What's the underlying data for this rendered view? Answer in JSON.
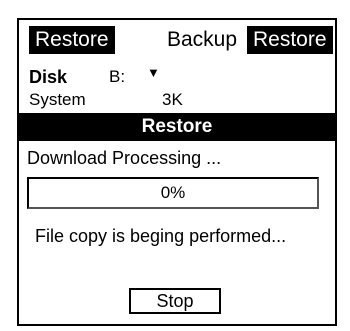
{
  "tabs": {
    "left": "Restore",
    "middle": "Backup",
    "right": "Restore"
  },
  "info": {
    "disk_label": "Disk",
    "disk_value": "B:",
    "disk_dropdown_icon": "triangle-down",
    "system_label": "System",
    "system_value": "3K"
  },
  "dialog": {
    "title": "Restore",
    "status_text": "Download Processing ...",
    "progress_value": 0,
    "progress_label": "0%",
    "message": "File copy is beging performed...",
    "stop_label": "Stop"
  }
}
